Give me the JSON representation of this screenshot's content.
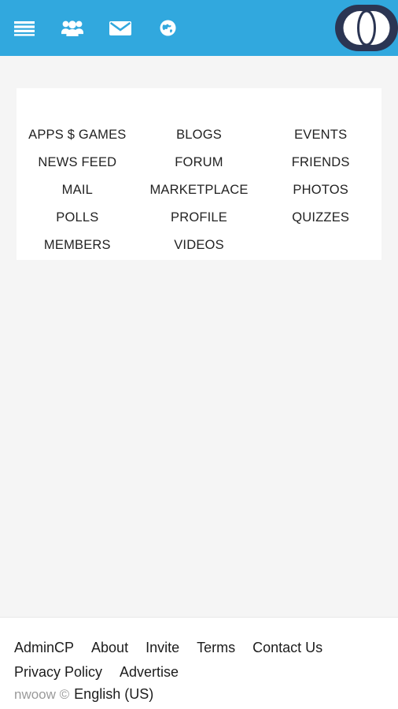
{
  "header": {
    "background_color": "#31a8de",
    "icons": [
      {
        "name": "hamburger-menu-icon",
        "label": "Menu"
      },
      {
        "name": "friends-group-icon",
        "label": "Friends"
      },
      {
        "name": "envelope-mail-icon",
        "label": "Mail"
      },
      {
        "name": "globe-notifications-icon",
        "label": "Notifications"
      }
    ],
    "logo": {
      "name": "nwoow-logo",
      "alt": "nwoow",
      "shape_color": "#2b3553",
      "mark_color": "#ffffff"
    }
  },
  "menu_card": {
    "background_color": "#ffffff",
    "columns": [
      {
        "items": [
          {
            "label": "APPS $ GAMES",
            "name": "menu-item-apps-games"
          },
          {
            "label": "NEWS FEED",
            "name": "menu-item-news-feed"
          },
          {
            "label": "MAIL",
            "name": "menu-item-mail"
          },
          {
            "label": "POLLS",
            "name": "menu-item-polls"
          },
          {
            "label": "MEMBERS",
            "name": "menu-item-members"
          }
        ]
      },
      {
        "items": [
          {
            "label": "BLOGS",
            "name": "menu-item-blogs"
          },
          {
            "label": "FORUM",
            "name": "menu-item-forum"
          },
          {
            "label": "MARKETPLACE",
            "name": "menu-item-marketplace"
          },
          {
            "label": "PROFILE",
            "name": "menu-item-profile"
          },
          {
            "label": "VIDEOS",
            "name": "menu-item-videos"
          }
        ]
      },
      {
        "items": [
          {
            "label": "EVENTS",
            "name": "menu-item-events"
          },
          {
            "label": "FRIENDS",
            "name": "menu-item-friends"
          },
          {
            "label": "PHOTOS",
            "name": "menu-item-photos"
          },
          {
            "label": "QUIZZES",
            "name": "menu-item-quizzes"
          }
        ]
      }
    ]
  },
  "footer": {
    "links_row_1": [
      {
        "label": "AdminCP",
        "name": "footer-link-admincp"
      },
      {
        "label": "About",
        "name": "footer-link-about"
      },
      {
        "label": "Invite",
        "name": "footer-link-invite"
      },
      {
        "label": "Terms",
        "name": "footer-link-terms"
      },
      {
        "label": "Contact Us",
        "name": "footer-link-contact-us"
      }
    ],
    "links_row_2": [
      {
        "label": "Privacy Policy",
        "name": "footer-link-privacy-policy"
      },
      {
        "label": "Advertise",
        "name": "footer-link-advertise"
      }
    ],
    "copyright": "nwoow ©",
    "language": "English (US)"
  },
  "page": {
    "body_background": "#f5f5f5"
  }
}
